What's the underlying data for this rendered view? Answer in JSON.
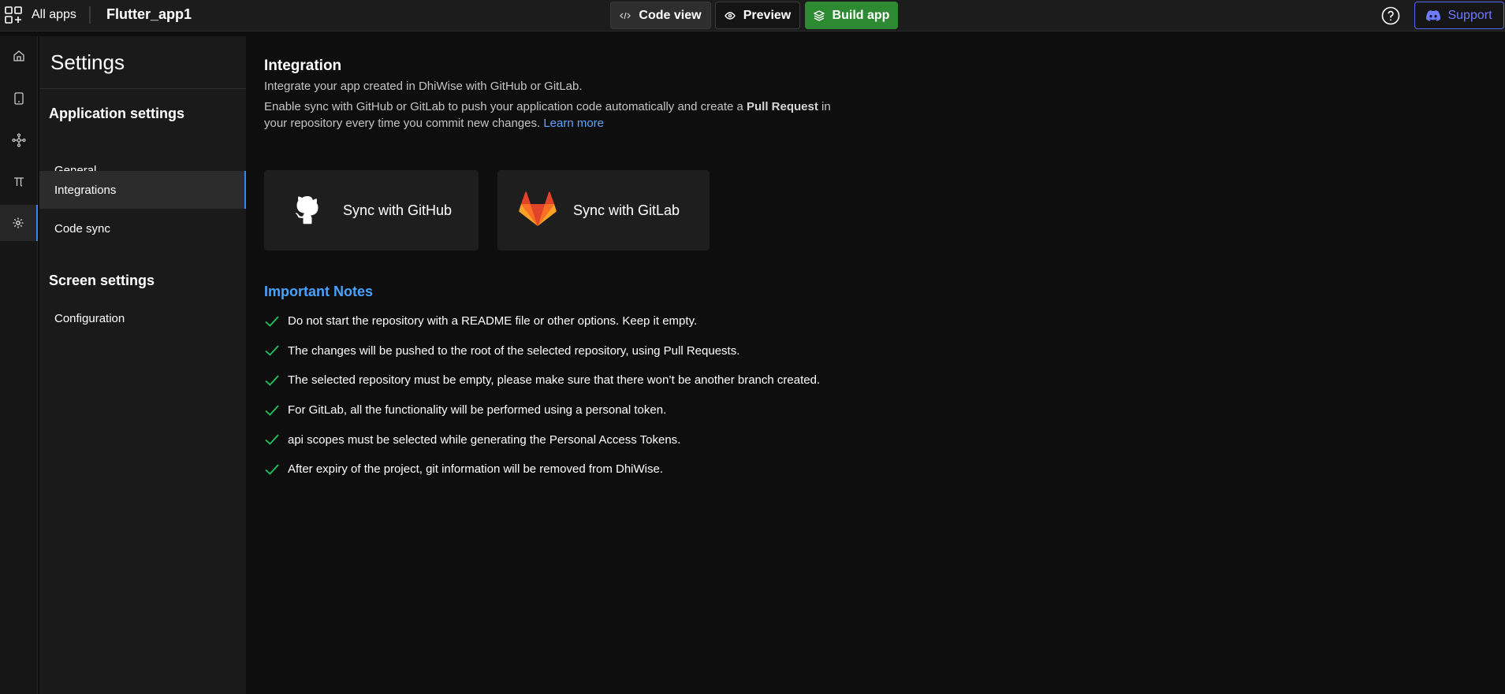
{
  "topbar": {
    "all_apps_label": "All apps",
    "app_name": "Flutter_app1",
    "code_view_label": "Code view",
    "preview_label": "Preview",
    "build_app_label": "Build app",
    "support_label": "Support"
  },
  "rail": {
    "items": [
      "home-icon",
      "device-icon",
      "flow-icon",
      "pi-icon",
      "gear-icon"
    ],
    "active": "gear-icon"
  },
  "sidebar": {
    "title": "Settings",
    "app_section": "Application settings",
    "app_items": [
      {
        "label": "General"
      },
      {
        "label": "Integrations",
        "active": true
      },
      {
        "label": "Code sync"
      }
    ],
    "screen_section": "Screen settings",
    "screen_items": [
      {
        "label": "Configuration"
      }
    ]
  },
  "main": {
    "title": "Integration",
    "subtitle": "Integrate your app created in DhiWise with GitHub or GitLab.",
    "desc_part1": "Enable sync with GitHub or GitLab to push your application code automatically and create a ",
    "desc_bold": "Pull Request",
    "desc_part2": " in your repository every time you commit new changes. ",
    "learn_more": "Learn more",
    "github_card": "Sync with GitHub",
    "gitlab_card": "Sync with GitLab",
    "notes_title": "Important Notes",
    "notes": [
      "Do not start the repository with a README file or other options. Keep it empty.",
      "The changes will be pushed to the root of the selected repository, using Pull Requests.",
      "The selected repository must be empty, please make sure that there won’t be another branch created.",
      "For GitLab, all the functionality will be performed using a personal token.",
      "api scopes must be selected while generating the Personal Access Tokens.",
      "After expiry of the project, git information will be removed from DhiWise."
    ]
  },
  "colors": {
    "accent_blue": "#3b82f6",
    "build_green": "#2e8a32",
    "discord": "#5865f2",
    "notes_blue": "#4aa3ff",
    "check_green": "#22c55e"
  }
}
